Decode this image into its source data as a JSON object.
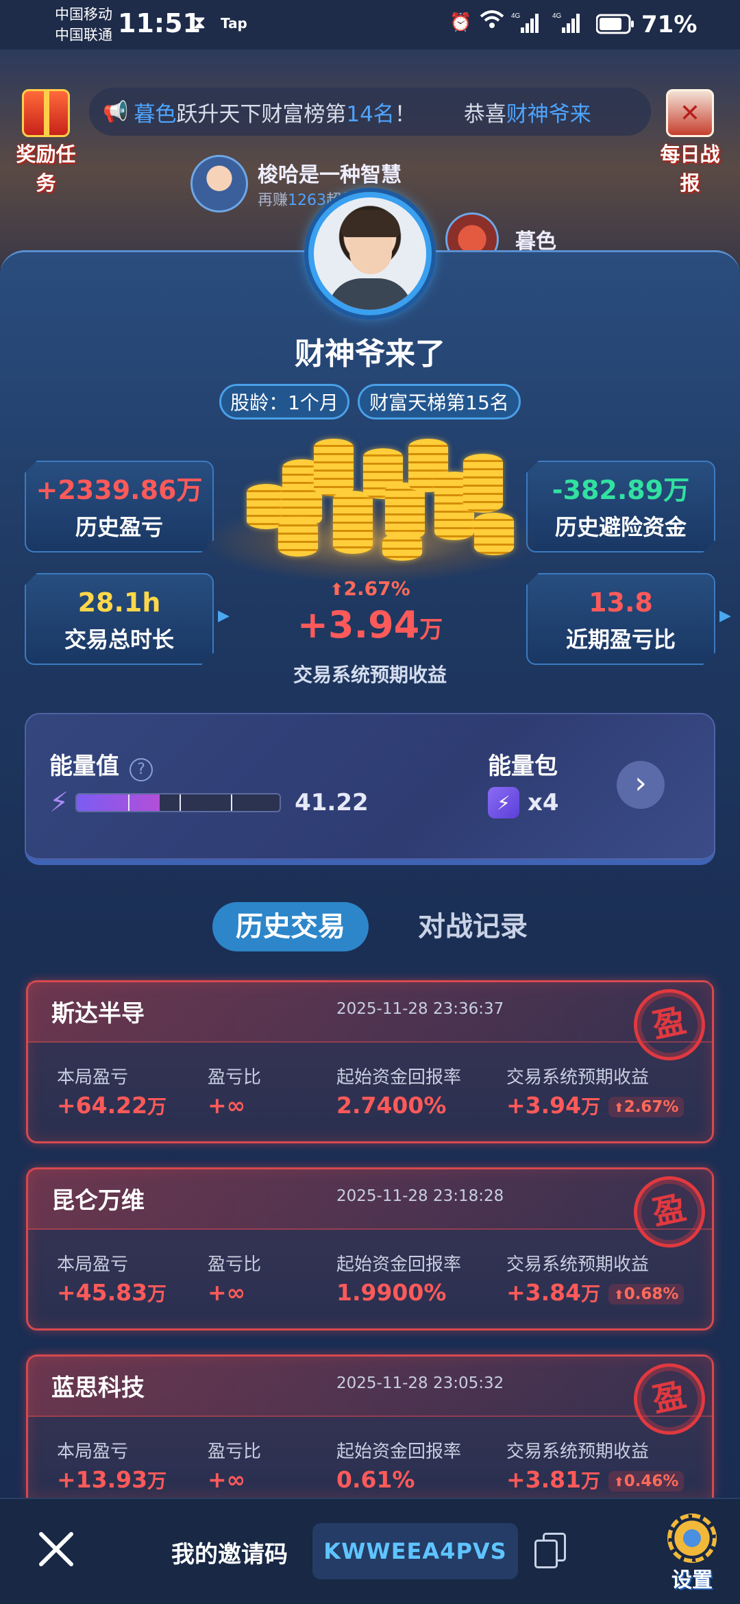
{
  "status_bar": {
    "carrier_1": "中国移动",
    "carrier_2": "中国联通",
    "time": "11:51",
    "app_tag": "Tap",
    "battery": "71%",
    "icons": [
      "hourglass-icon",
      "alarm-icon",
      "wifi-icon",
      "signal-4g-icon",
      "signal-4g-icon",
      "battery-icon"
    ]
  },
  "top": {
    "reward_label": "奖励任务",
    "daily_label": "每日战报",
    "marquee_prefix": "暮色",
    "marquee_middle": "跃升天下财富榜第",
    "marquee_rank": "14名",
    "marquee_suffix": "！",
    "marquee_congrats": "恭喜",
    "marquee_name2": "财神爷来",
    "rank_user_1": "梭哈是一种智慧",
    "rank_user_1_sub_prefix": "再赚",
    "rank_user_1_sub_value": "1263",
    "rank_user_1_sub_suffix": "超越TA",
    "rank_user_2": "暮色"
  },
  "profile": {
    "name": "财神爷来了",
    "stock_age": "股龄：1个月",
    "wealth_rank": "财富天梯第15名"
  },
  "stats": {
    "history_pnl_value": "+2339.86万",
    "history_pnl_label": "历史盈亏",
    "history_hedge_value": "-382.89万",
    "history_hedge_label": "历史避险资金",
    "trade_time_value": "28.1h",
    "trade_time_label": "交易总时长",
    "recent_ratio_value": "13.8",
    "recent_ratio_label": "近期盈亏比",
    "expected_rate": "2.67%",
    "expected_value": "+3.94",
    "expected_unit": "万",
    "expected_label": "交易系统预期收益"
  },
  "energy": {
    "title": "能量值",
    "value": "41.22",
    "fill_fraction": 0.41,
    "pack_title": "能量包",
    "pack_count": "x4"
  },
  "tabs": {
    "history": "历史交易",
    "battle": "对战记录"
  },
  "columns": {
    "pnl": "本局盈亏",
    "ratio": "盈亏比",
    "return_rate": "起始资金回报率",
    "expected": "交易系统预期收益"
  },
  "trades": [
    {
      "name": "斯达半导",
      "time": "2025-11-28 23:36:37",
      "pnl": "+64.22",
      "ratio": "+∞",
      "return_rate": "2.7400%",
      "expected": "+3.94",
      "expected_rate": "2.67%",
      "seal": "盈"
    },
    {
      "name": "昆仑万维",
      "time": "2025-11-28 23:18:28",
      "pnl": "+45.83",
      "ratio": "+∞",
      "return_rate": "1.9900%",
      "expected": "+3.84",
      "expected_rate": "0.68%",
      "seal": "盈"
    },
    {
      "name": "蓝思科技",
      "time": "2025-11-28 23:05:32",
      "pnl": "+13.93",
      "ratio": "+∞",
      "return_rate": "0.61%",
      "expected": "+3.81",
      "expected_rate": "0.46%",
      "seal": "盈"
    }
  ],
  "unit_wan": "万",
  "bottom": {
    "invite_label": "我的邀请码",
    "invite_code": "KWWEEA4PVS",
    "settings_label": "设置"
  }
}
